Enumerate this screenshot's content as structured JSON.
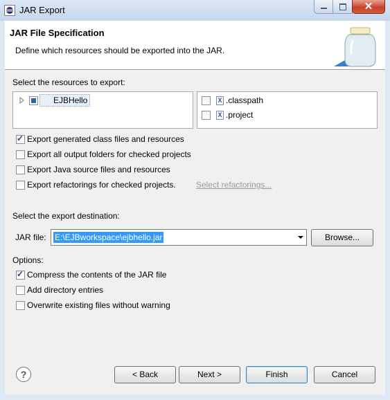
{
  "window": {
    "title": "JAR Export",
    "close_glyph": "✕"
  },
  "header": {
    "title": "JAR File Specification",
    "description": "Define which resources should be exported into the JAR."
  },
  "resources": {
    "label": "Select the resources to export:",
    "tree": [
      {
        "name": "EJBHello",
        "icon": "folder-project-icon",
        "state": "partial"
      }
    ],
    "files": [
      {
        "name": ".classpath",
        "checked": false
      },
      {
        "name": ".project",
        "checked": false
      }
    ]
  },
  "export_options": [
    {
      "label": "Export generated class files and resources",
      "checked": true
    },
    {
      "label": "Export all output folders for checked projects",
      "checked": false
    },
    {
      "label": "Export Java source files and resources",
      "checked": false
    },
    {
      "label": "Export refactorings for checked projects.",
      "checked": false,
      "link": "Select refactorings..."
    }
  ],
  "destination": {
    "label": "Select the export destination:",
    "jar_label": "JAR file:",
    "jar_value": "E:\\EJBworkspace\\ejbhello.jar",
    "browse_label": "Browse..."
  },
  "options": {
    "label": "Options:",
    "items": [
      {
        "label": "Compress the contents of the JAR file",
        "checked": true
      },
      {
        "label": "Add directory entries",
        "checked": false
      },
      {
        "label": "Overwrite existing files without warning",
        "checked": false
      }
    ]
  },
  "footer": {
    "help_glyph": "?",
    "back_label": "< Back",
    "next_label": "Next >",
    "finish_label": "Finish",
    "cancel_label": "Cancel"
  },
  "colors": {
    "selection": "#3399ff",
    "link": "#9a9a9a"
  }
}
